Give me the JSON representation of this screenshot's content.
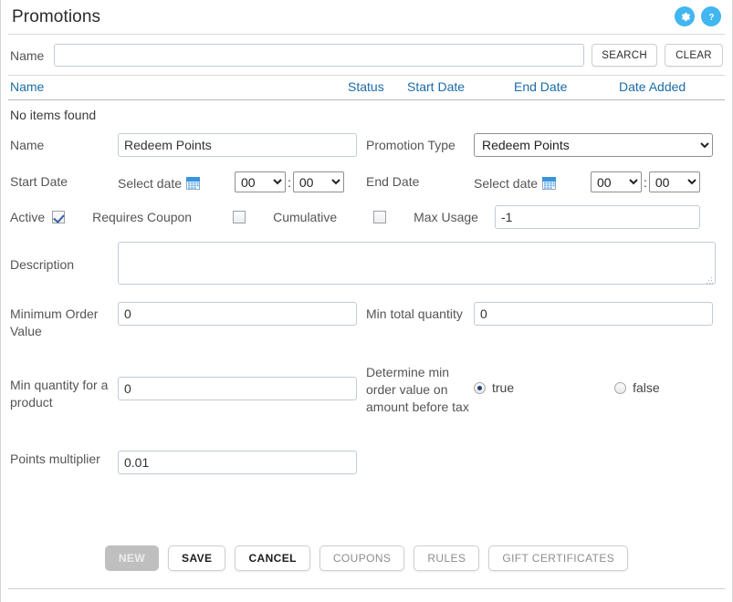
{
  "header": {
    "title": "Promotions",
    "settings_icon": "gear-icon",
    "help_icon": "question-mark-icon"
  },
  "search": {
    "label": "Name",
    "value": "",
    "placeholder": "",
    "search_button": "SEARCH",
    "clear_button": "CLEAR"
  },
  "results_table": {
    "columns": [
      "Name",
      "Status",
      "Start Date",
      "End Date",
      "Date Added"
    ],
    "empty_message": "No items found",
    "rows": []
  },
  "form": {
    "name": {
      "label": "Name",
      "value": "Redeem Points"
    },
    "promotion_type": {
      "label": "Promotion Type",
      "value": "Redeem Points",
      "options": [
        "Redeem Points"
      ]
    },
    "start_date": {
      "label": "Start Date",
      "picker_text": "Select date",
      "calendar_icon": "calendar-icon",
      "hour": "00",
      "minute": "00",
      "separator": ":"
    },
    "end_date": {
      "label": "End Date",
      "picker_text": "Select date",
      "calendar_icon": "calendar-icon",
      "hour": "00",
      "minute": "00",
      "separator": ":"
    },
    "active": {
      "label": "Active",
      "checked": true
    },
    "requires_coupon": {
      "label": "Requires Coupon",
      "checked": false
    },
    "cumulative": {
      "label": "Cumulative",
      "checked": false
    },
    "max_usage": {
      "label": "Max Usage",
      "value": "-1"
    },
    "description": {
      "label": "Description",
      "value": ""
    },
    "minimum_order_value": {
      "label": "Minimum Order Value",
      "value": "0"
    },
    "min_total_quantity": {
      "label": "Min total quantity",
      "value": "0"
    },
    "min_quantity_for_product": {
      "label": "Min quantity for a product",
      "value": "0"
    },
    "determine_min_order_before_tax": {
      "label": "Determine min order value on amount before tax",
      "options": [
        "true",
        "false"
      ],
      "selected": "true"
    },
    "points_multiplier": {
      "label": "Points multiplier",
      "value": "0.01"
    }
  },
  "actions": {
    "new": "NEW",
    "save": "SAVE",
    "cancel": "CANCEL",
    "coupons": "COUPONS",
    "rules": "RULES",
    "gift_certificates": "GIFT CERTIFICATES"
  },
  "colors": {
    "accent_blue": "#41b6f0",
    "link_blue": "#1b6ca8",
    "disabled_gray": "#bfbfbf",
    "border": "#c2cbd4"
  }
}
